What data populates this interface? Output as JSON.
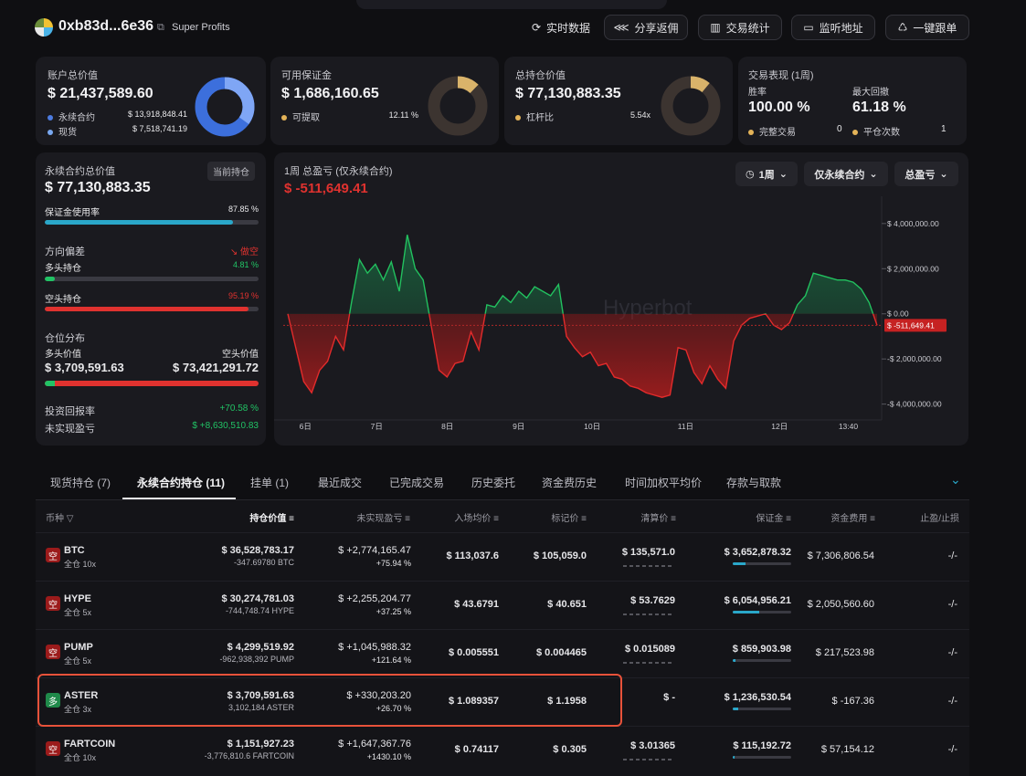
{
  "header": {
    "address": "0xb83d...6e36",
    "tag": "Super Profits",
    "buttons": [
      "实时数据",
      "分享返佣",
      "交易统计",
      "监听地址",
      "一键跟单"
    ]
  },
  "cards": {
    "account": {
      "label": "账户总价值",
      "value": "$ 21,437,589.60",
      "perp_label": "永续合约",
      "perp_value": "$ 13,918,848.41",
      "spot_label": "现货",
      "spot_value": "$ 7,518,741.19"
    },
    "margin": {
      "label": "可用保证金",
      "value": "$ 1,686,160.65",
      "sub_label": "可提取",
      "sub_value": "12.11 %"
    },
    "position": {
      "label": "总持仓价值",
      "value": "$ 77,130,883.35",
      "sub_label": "杠杆比",
      "sub_value": "5.54x"
    },
    "performance": {
      "label": "交易表现 (1周)",
      "winrate_label": "胜率",
      "winrate": "100.00 %",
      "drawdown_label": "最大回撤",
      "drawdown": "61.18 %",
      "done_label": "完整交易",
      "done_value": "0",
      "close_label": "平仓次数",
      "close_value": "1"
    }
  },
  "perp": {
    "label": "永续合约总价值",
    "badge": "当前持仓",
    "value": "$ 77,130,883.35",
    "usage_label": "保证金使用率",
    "usage": "87.85 %",
    "usage_frac": 0.8785,
    "bias_label": "方向偏差",
    "bias_value": "做空",
    "long_label": "多头持仓",
    "long_pct": "4.81 %",
    "long_frac": 0.0481,
    "short_label": "空头持仓",
    "short_pct": "95.19 %",
    "short_frac": 0.9519,
    "dist_label": "仓位分布",
    "long_value_label": "多头价值",
    "short_value_label": "空头价值",
    "long_value": "$ 3,709,591.63",
    "short_value": "$ 73,421,291.72",
    "dist_long_frac": 0.0481,
    "roi_label": "投资回报率",
    "roi": "+70.58 %",
    "upnl_label": "未实现盈亏",
    "upnl": "$ +8,630,510.83"
  },
  "chart": {
    "title": "1周 总盈亏 (仅永续合约)",
    "value": "$ -511,649.41",
    "controls": [
      "1周",
      "仅永续合约",
      "总盈亏"
    ],
    "watermark": "Hyperbot",
    "current_label": "$ -511,649.41"
  },
  "chart_data": {
    "type": "area",
    "y_ticks": [
      "$ 4,000,000.00",
      "$ 2,000,000.00",
      "$ 0.00",
      "-$ 2,000,000.00",
      "-$ 4,000,000.00"
    ],
    "x_ticks": [
      "6日",
      "7日",
      "8日",
      "9日",
      "10日",
      "11日",
      "12日",
      "13:40"
    ],
    "ylim": [
      -4500000,
      4600000
    ],
    "points": [
      0,
      -1500000,
      -3000000,
      -3500000,
      -2500000,
      -2100000,
      -1000000,
      -1600000,
      500000,
      2400000,
      1800000,
      2200000,
      1500000,
      2300000,
      1000000,
      3500000,
      2000000,
      1500000,
      -500000,
      -2500000,
      -2800000,
      -2200000,
      -2100000,
      -800000,
      -1600000,
      400000,
      300000,
      800000,
      500000,
      1000000,
      700000,
      1200000,
      1000000,
      800000,
      1300000,
      -1000000,
      -1500000,
      -1900000,
      -1700000,
      -2300000,
      -2200000,
      -2800000,
      -2900000,
      -3200000,
      -3300000,
      -3500000,
      -3600000,
      -3700000,
      -3600000,
      -1500000,
      -1600000,
      -2600000,
      -3100000,
      -2300000,
      -2900000,
      -3300000,
      -1200000,
      -500000,
      -200000,
      -100000,
      0,
      -500000,
      -700000,
      -400000,
      400000,
      800000,
      1800000,
      1700000,
      1600000,
      1500000,
      1500000,
      1400000,
      1100000,
      500000,
      -511649
    ]
  },
  "tabs": [
    "现货持仓 (7)",
    "永续合约持仓 (11)",
    "挂单 (1)",
    "最近成交",
    "已完成交易",
    "历史委托",
    "资金费历史",
    "时间加权平均价",
    "存款与取款"
  ],
  "table": {
    "headers": [
      "币种",
      "持仓价值",
      "未实现盈亏",
      "入场均价",
      "标记价",
      "清算价",
      "保证金",
      "资金费用",
      "止盈/止损"
    ],
    "rows": [
      {
        "side": "空",
        "coin": "BTC",
        "mode": "全仓 10x",
        "value": "$ 36,528,783.17",
        "size": "-347.69780 BTC",
        "pnl": "$ +2,774,165.47",
        "pnl_pct": "+75.94 %",
        "entry": "$ 113,037.6",
        "mark": "$ 105,059.0",
        "liq": "$ 135,571.0",
        "margin": "$ 3,652,878.32",
        "funding": "$ 7,306,806.54",
        "tpsl": "-/-",
        "mfrac": 0.22,
        "pos": "short"
      },
      {
        "side": "空",
        "coin": "HYPE",
        "mode": "全仓 5x",
        "value": "$ 30,274,781.03",
        "size": "-744,748.74 HYPE",
        "pnl": "$ +2,255,204.77",
        "pnl_pct": "+37.25 %",
        "entry": "$ 43.6791",
        "mark": "$ 40.651",
        "liq": "$ 53.7629",
        "margin": "$ 6,054,956.21",
        "funding": "$ 2,050,560.60",
        "tpsl": "-/-",
        "mfrac": 0.45,
        "pos": "short"
      },
      {
        "side": "空",
        "coin": "PUMP",
        "mode": "全仓 5x",
        "value": "$ 4,299,519.92",
        "size": "-962,938,392 PUMP",
        "pnl": "$ +1,045,988.32",
        "pnl_pct": "+121.64 %",
        "entry": "$ 0.005551",
        "mark": "$ 0.004465",
        "liq": "$ 0.015089",
        "margin": "$ 859,903.98",
        "funding": "$ 217,523.98",
        "tpsl": "-/-",
        "mfrac": 0.05,
        "pos": "short"
      },
      {
        "side": "多",
        "coin": "ASTER",
        "mode": "全仓 3x",
        "value": "$ 3,709,591.63",
        "size": "3,102,184 ASTER",
        "pnl": "$ +330,203.20",
        "pnl_pct": "+26.70 %",
        "entry": "$ 1.089357",
        "mark": "$ 1.1958",
        "liq": "$ -",
        "margin": "$ 1,236,530.54",
        "funding": "$ -167.36",
        "tpsl": "-/-",
        "mfrac": 0.1,
        "pos": "long"
      },
      {
        "side": "空",
        "coin": "FARTCOIN",
        "mode": "全仓 10x",
        "value": "$ 1,151,927.23",
        "size": "-3,776,810.6 FARTCOIN",
        "pnl": "$ +1,647,367.76",
        "pnl_pct": "+1430.10 %",
        "entry": "$ 0.74117",
        "mark": "$ 0.305",
        "liq": "$ 3.01365",
        "margin": "$ 115,192.72",
        "funding": "$ 57,154.12",
        "tpsl": "-/-",
        "mfrac": 0.03,
        "pos": "short"
      }
    ]
  },
  "colors": {
    "green": "#21c365",
    "red": "#e0322f",
    "accent": "#2aa7c9",
    "highlight": "#e8523a",
    "card": "#1a1a1f"
  }
}
